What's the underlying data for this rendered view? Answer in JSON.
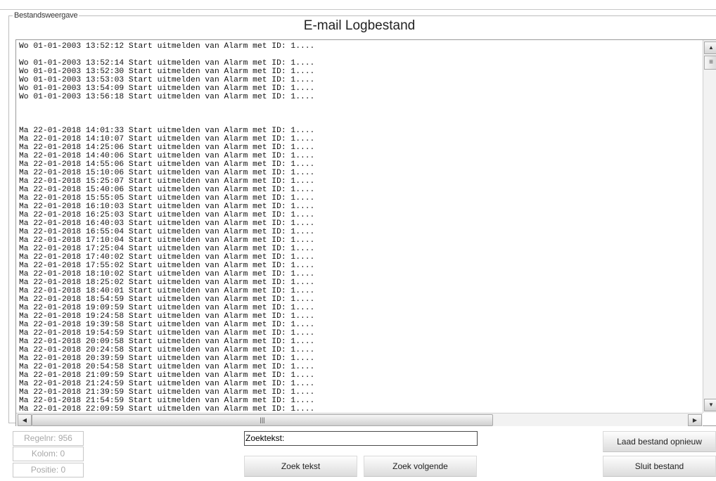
{
  "window": {
    "group_label": "Bestandsweergave",
    "title": "E-mail Logbestand"
  },
  "log": {
    "lines": [
      "Wo 01-01-2003 13:52:12 Start uitmelden van Alarm met ID: 1....",
      "",
      "Wo 01-01-2003 13:52:14 Start uitmelden van Alarm met ID: 1....",
      "Wo 01-01-2003 13:52:30 Start uitmelden van Alarm met ID: 1....",
      "Wo 01-01-2003 13:53:03 Start uitmelden van Alarm met ID: 1....",
      "Wo 01-01-2003 13:54:09 Start uitmelden van Alarm met ID: 1....",
      "Wo 01-01-2003 13:56:18 Start uitmelden van Alarm met ID: 1....",
      "",
      "",
      "",
      "Ma 22-01-2018 14:01:33 Start uitmelden van Alarm met ID: 1....",
      "Ma 22-01-2018 14:10:07 Start uitmelden van Alarm met ID: 1....",
      "Ma 22-01-2018 14:25:06 Start uitmelden van Alarm met ID: 1....",
      "Ma 22-01-2018 14:40:06 Start uitmelden van Alarm met ID: 1....",
      "Ma 22-01-2018 14:55:06 Start uitmelden van Alarm met ID: 1....",
      "Ma 22-01-2018 15:10:06 Start uitmelden van Alarm met ID: 1....",
      "Ma 22-01-2018 15:25:07 Start uitmelden van Alarm met ID: 1....",
      "Ma 22-01-2018 15:40:06 Start uitmelden van Alarm met ID: 1....",
      "Ma 22-01-2018 15:55:05 Start uitmelden van Alarm met ID: 1....",
      "Ma 22-01-2018 16:10:03 Start uitmelden van Alarm met ID: 1....",
      "Ma 22-01-2018 16:25:03 Start uitmelden van Alarm met ID: 1....",
      "Ma 22-01-2018 16:40:03 Start uitmelden van Alarm met ID: 1....",
      "Ma 22-01-2018 16:55:04 Start uitmelden van Alarm met ID: 1....",
      "Ma 22-01-2018 17:10:04 Start uitmelden van Alarm met ID: 1....",
      "Ma 22-01-2018 17:25:04 Start uitmelden van Alarm met ID: 1....",
      "Ma 22-01-2018 17:40:02 Start uitmelden van Alarm met ID: 1....",
      "Ma 22-01-2018 17:55:02 Start uitmelden van Alarm met ID: 1....",
      "Ma 22-01-2018 18:10:02 Start uitmelden van Alarm met ID: 1....",
      "Ma 22-01-2018 18:25:02 Start uitmelden van Alarm met ID: 1....",
      "Ma 22-01-2018 18:40:01 Start uitmelden van Alarm met ID: 1....",
      "Ma 22-01-2018 18:54:59 Start uitmelden van Alarm met ID: 1....",
      "Ma 22-01-2018 19:09:59 Start uitmelden van Alarm met ID: 1....",
      "Ma 22-01-2018 19:24:58 Start uitmelden van Alarm met ID: 1....",
      "Ma 22-01-2018 19:39:58 Start uitmelden van Alarm met ID: 1....",
      "Ma 22-01-2018 19:54:59 Start uitmelden van Alarm met ID: 1....",
      "Ma 22-01-2018 20:09:58 Start uitmelden van Alarm met ID: 1....",
      "Ma 22-01-2018 20:24:58 Start uitmelden van Alarm met ID: 1....",
      "Ma 22-01-2018 20:39:59 Start uitmelden van Alarm met ID: 1....",
      "Ma 22-01-2018 20:54:58 Start uitmelden van Alarm met ID: 1....",
      "Ma 22-01-2018 21:09:59 Start uitmelden van Alarm met ID: 1....",
      "Ma 22-01-2018 21:24:59 Start uitmelden van Alarm met ID: 1....",
      "Ma 22-01-2018 21:39:59 Start uitmelden van Alarm met ID: 1....",
      "Ma 22-01-2018 21:54:59 Start uitmelden van Alarm met ID: 1....",
      "Ma 22-01-2018 22:09:59 Start uitmelden van Alarm met ID: 1...."
    ]
  },
  "status": {
    "line": "Regelnr: 956",
    "column": "Kolom: 0",
    "position": "Positie: 0"
  },
  "search": {
    "value": "Zoektekst:"
  },
  "buttons": {
    "search_text": "Zoek tekst",
    "search_next": "Zoek volgende",
    "reload": "Laad bestand opnieuw",
    "close": "Sluit bestand"
  },
  "icons": {
    "scroll_up": "▲",
    "scroll_down": "▼",
    "scroll_left": "◀",
    "scroll_right": "▶",
    "vthumb_grip": "≡",
    "hthumb_grip": "|||"
  }
}
